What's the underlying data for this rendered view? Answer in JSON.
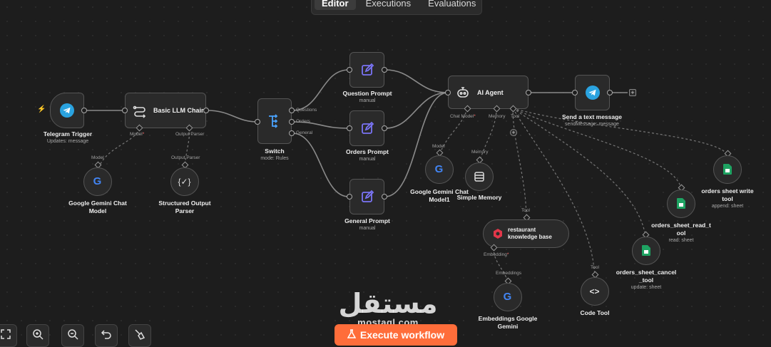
{
  "tabs": [
    {
      "label": "Editor",
      "active": true
    },
    {
      "label": "Executions",
      "active": false
    },
    {
      "label": "Evaluations",
      "active": false
    }
  ],
  "nodes": {
    "telegram_trigger": {
      "title": "Telegram Trigger",
      "subtitle": "Updates: message",
      "icon": "telegram-icon"
    },
    "basic_llm_chain": {
      "title": "Basic LLM Chain",
      "icon": "chain-icon",
      "port_model": "Model",
      "port_parser": "Output Parser"
    },
    "gemini_chat_model": {
      "title_line1": "Google Gemini Chat",
      "title_line2": "Model",
      "port": "Model",
      "icon": "google-icon"
    },
    "structured_output_parser": {
      "title_line1": "Structured Output",
      "title_line2": "Parser",
      "port": "Output Parser",
      "icon": "braces-icon"
    },
    "switch": {
      "title": "Switch",
      "subtitle": "mode: Rules",
      "icon": "switch-icon",
      "outputs": [
        "Questions",
        "Orders",
        "General"
      ]
    },
    "question_prompt": {
      "title": "Question Prompt",
      "subtitle": "manual",
      "icon": "edit-icon"
    },
    "orders_prompt": {
      "title": "Orders Prompt",
      "subtitle": "manual",
      "icon": "edit-icon"
    },
    "general_prompt": {
      "title": "General Prompt",
      "subtitle": "manual",
      "icon": "edit-icon"
    },
    "ai_agent": {
      "title": "AI Agent",
      "icon": "robot-icon",
      "port_chat_model": "Chat Model",
      "port_memory": "Memory",
      "port_tool": "Tool"
    },
    "send_text": {
      "title": "Send a text message",
      "subtitle": "sendMessage: message",
      "icon": "telegram-icon"
    },
    "gemini_chat_model1": {
      "title_line1": "Google Gemini Chat",
      "title_line2": "Model1",
      "port": "Model",
      "icon": "google-icon"
    },
    "simple_memory": {
      "title": "Simple Memory",
      "port": "Memory",
      "icon": "database-icon"
    },
    "knowledge_base": {
      "title_line1": "restaurant",
      "title_line2": "knowledge base",
      "port": "Tool",
      "port_embedding": "Embedding",
      "icon": "vector-store-icon"
    },
    "embeddings_gemini": {
      "title_line1": "Embeddings Google",
      "title_line2": "Gemini",
      "port": "Embeddings",
      "icon": "google-icon"
    },
    "code_tool": {
      "title": "Code Tool",
      "port": "Tool",
      "icon": "code-icon"
    },
    "orders_cancel": {
      "title_line1": "orders_sheet_cancel",
      "title_line2": "_tool",
      "subtitle": "update: sheet",
      "icon": "sheets-icon"
    },
    "orders_read": {
      "title_line1": "orders_sheet_read_t",
      "title_line2": "ool",
      "subtitle": "read: sheet",
      "icon": "sheets-icon"
    },
    "orders_write": {
      "title_line1": "orders sheet write",
      "title_line2": "tool",
      "subtitle": "append: sheet",
      "icon": "sheets-icon"
    }
  },
  "required_marker": "*",
  "add_marker": "+",
  "execute_label": "Execute workflow",
  "watermark": {
    "arabic": "مستقل",
    "latin": "mostaql.com"
  },
  "toolbar": [
    "fit-view-icon",
    "zoom-in-icon",
    "zoom-out-icon",
    "undo-icon",
    "clear-icon"
  ],
  "colors": {
    "accent": "#ff6d3a",
    "telegram": "#2aa3e0",
    "prompt": "#7a74f5",
    "sheets": "#1ea362",
    "vector": "#e2374a"
  }
}
